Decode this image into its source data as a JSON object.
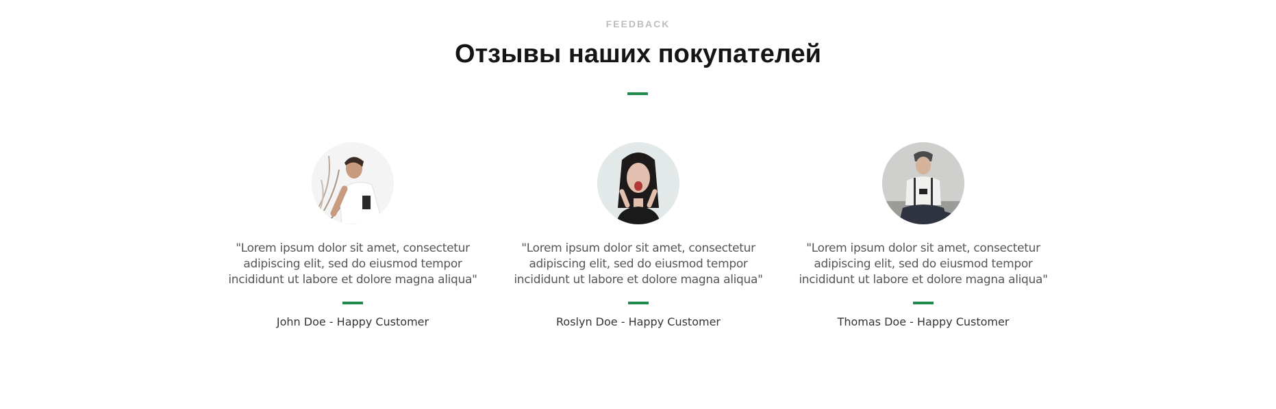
{
  "section": {
    "eyebrow": "FEEDBACK",
    "title": "Отзывы наших покупателей",
    "accent_color": "#1f8a4c"
  },
  "testimonials": [
    {
      "quote": "\"Lorem ipsum dolor sit amet, consectetur adipiscing elit, sed do eiusmod tempor incididunt ut labore et dolore magna aliqua\"",
      "author": "John Doe - Happy Customer",
      "avatar_icon": "man-photo"
    },
    {
      "quote": "\"Lorem ipsum dolor sit amet, consectetur adipiscing elit, sed do eiusmod tempor incididunt ut labore et dolore magna aliqua\"",
      "author": "Roslyn Doe - Happy Customer",
      "avatar_icon": "woman-photo"
    },
    {
      "quote": "\"Lorem ipsum dolor sit amet, consectetur adipiscing elit, sed do eiusmod tempor incididunt ut labore et dolore magna aliqua\"",
      "author": "Thomas Doe - Happy Customer",
      "avatar_icon": "man-phone-photo"
    }
  ]
}
